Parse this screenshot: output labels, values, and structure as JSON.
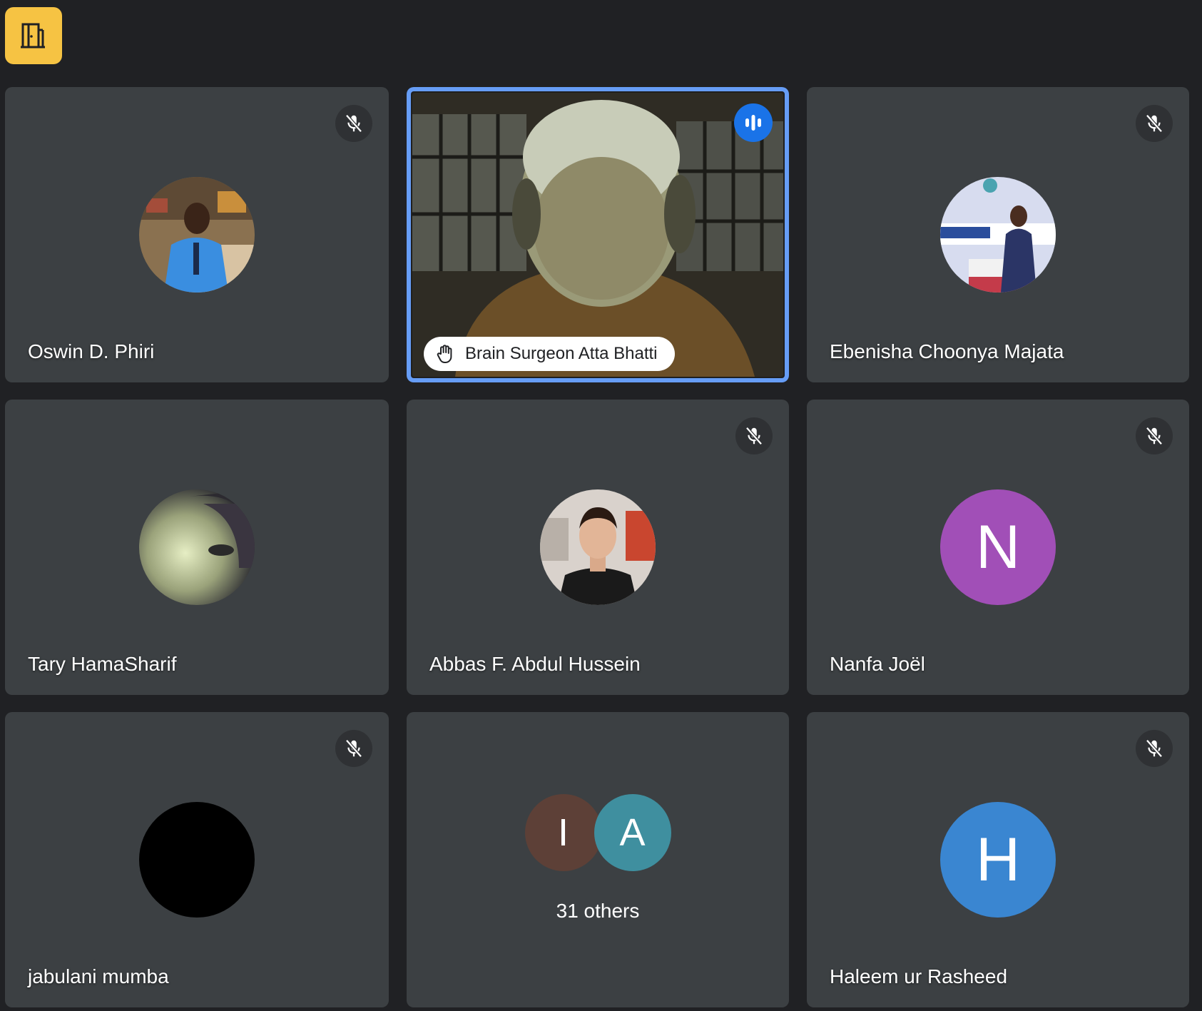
{
  "toolbar": {
    "breakout_icon": "door-exit-icon"
  },
  "colors": {
    "page_bg": "#202124",
    "tile_bg": "#3c4043",
    "speaking_border": "#669df6",
    "speaking_badge": "#1a73e8",
    "breakout_button": "#f6c343"
  },
  "participants": [
    {
      "name": "Oswin D. Phiri",
      "muted": true,
      "avatar": "photo"
    },
    {
      "name": "Brain Surgeon Atta Bhatti",
      "speaking": true,
      "hand_raised": true,
      "video_on": true
    },
    {
      "name": "Ebenisha Choonya Majata",
      "muted": true,
      "avatar": "photo"
    },
    {
      "name": "Tary HamaSharif",
      "muted": false,
      "avatar": "photo"
    },
    {
      "name": "Abbas F. Abdul Hussein",
      "muted": true,
      "avatar": "photo"
    },
    {
      "name": "Nanfa Joël",
      "muted": true,
      "avatar_letter": "N",
      "avatar_color": "#a14fb7"
    },
    {
      "name": "jabulani mumba",
      "muted": true,
      "avatar": "black"
    },
    {
      "name": "Haleem ur Rasheed",
      "muted": true,
      "avatar_letter": "H",
      "avatar_color": "#3a86d1"
    }
  ],
  "others": {
    "label": "31 others",
    "avatars": [
      {
        "letter": "I",
        "color": "#5d4037"
      },
      {
        "letter": "A",
        "color": "#3f8f9f"
      }
    ]
  }
}
